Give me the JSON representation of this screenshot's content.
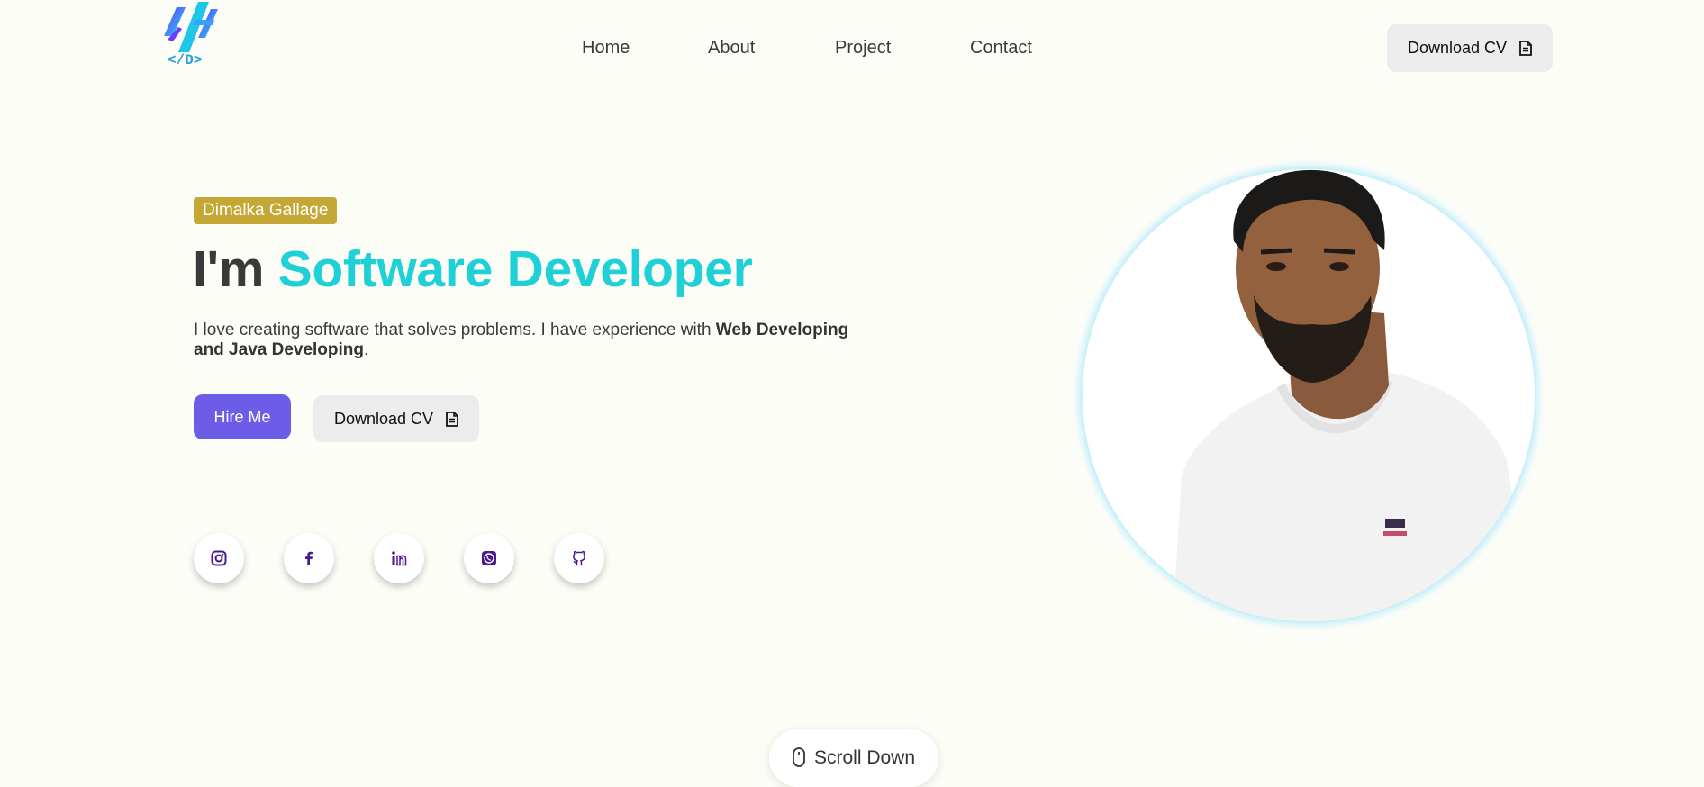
{
  "nav": {
    "logo_text": "</D>",
    "links": [
      "Home",
      "About",
      "Project",
      "Contact"
    ],
    "cv_label": "Download CV"
  },
  "hero": {
    "name_badge": "Dimalka Gallage",
    "headline_prefix": "I'm ",
    "headline_accent": "Software Developer",
    "description_plain": "I love creating software that solves problems. I have experience with ",
    "description_bold": "Web Developing and Java Developing",
    "description_end": ".",
    "hire_label": "Hire Me",
    "cv_label": "Download CV"
  },
  "socials": [
    {
      "name": "instagram-icon"
    },
    {
      "name": "facebook-icon"
    },
    {
      "name": "linkedin-icon"
    },
    {
      "name": "whatsapp-icon"
    },
    {
      "name": "github-icon"
    }
  ],
  "scroll": {
    "label": "Scroll Down"
  },
  "colors": {
    "accent": "#1fd1d6",
    "badge": "#c4a734",
    "primary_button": "#6c5ce7",
    "icon": "#4b1a8c"
  }
}
